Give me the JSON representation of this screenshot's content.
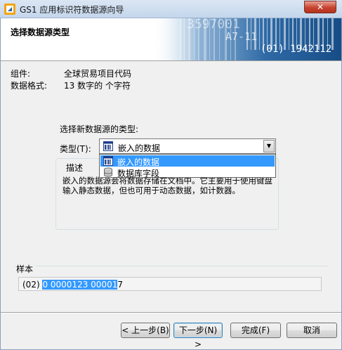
{
  "window": {
    "title": "GS1 应用标识符数据源向导",
    "close_label": "✕"
  },
  "header": {
    "title": "选择数据源类型",
    "banner": {
      "numbers": "3597001",
      "tag": "A7-11",
      "code": "(01) 1942112"
    }
  },
  "info": {
    "component_label": "组件:",
    "component_value": "全球贸易项目代码",
    "format_label": "数据格式:",
    "format_value": "13 数字的 个字符"
  },
  "source": {
    "prompt": "选择新数据源的类型:",
    "type_label": "类型(T):",
    "selected": "嵌入的数据",
    "options": [
      {
        "label": "嵌入的数据",
        "icon": "embedded-data-icon",
        "selected": true
      },
      {
        "label": "数据库字段",
        "icon": "database-icon",
        "selected": false
      }
    ]
  },
  "description": {
    "title": "描述",
    "text": "嵌入的数据源会将数据存储在文档中。它主要用于使用键盘输入静态数据，但也可用于动态数据，如计数器。"
  },
  "sample": {
    "title": "样本",
    "prefix": "(02) ",
    "highlighted": "0 0000123 00001",
    "suffix": "7"
  },
  "buttons": {
    "back": "< 上一步(B)",
    "next": "下一步(N) >",
    "finish": "完成(F)",
    "cancel": "取消"
  },
  "colors": {
    "selection": "#3399ff",
    "banner": "#1d5a96"
  }
}
